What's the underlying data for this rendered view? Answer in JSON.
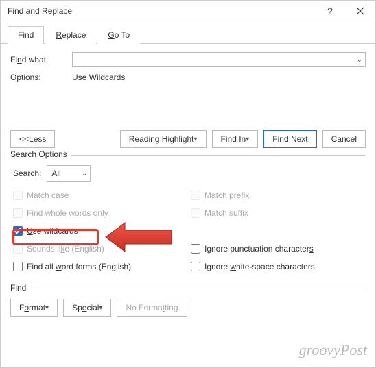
{
  "window": {
    "title": "Find and Replace"
  },
  "tabs": {
    "find": "Find",
    "replace": "Replace",
    "goto": "Go To"
  },
  "labels": {
    "find_what": "Find what:",
    "options": "Options:",
    "options_value": "Use Wildcards",
    "search_options": "Search Options",
    "search": "Search:",
    "search_value": "All",
    "find_section": "Find"
  },
  "buttons": {
    "less": "<< Less",
    "reading_highlight": "Reading Highlight",
    "find_in": "Find In",
    "find_next": "Find Next",
    "cancel": "Cancel",
    "format": "Format",
    "special": "Special",
    "no_formatting": "No Formatting"
  },
  "checks": {
    "match_case": "Match case",
    "whole_words": "Find whole words only",
    "use_wildcards": "Use wildcards",
    "sounds_like": "Sounds like (English)",
    "word_forms": "Find all word forms (English)",
    "match_prefix": "Match prefix",
    "match_suffix": "Match suffix",
    "ignore_punct": "Ignore punctuation characters",
    "ignore_ws": "Ignore white-space characters"
  },
  "watermark": "groovyPost"
}
